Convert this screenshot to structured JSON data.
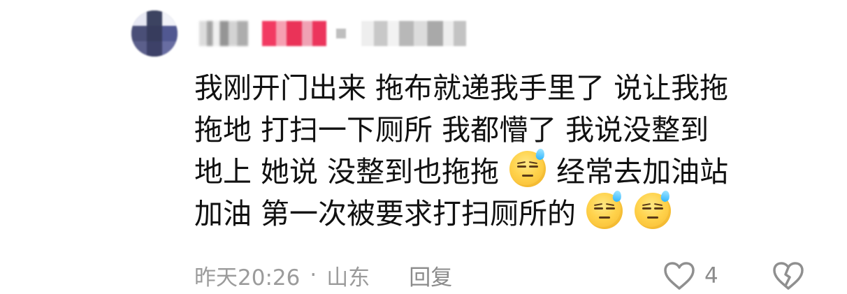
{
  "comment": {
    "content_lines": [
      {
        "a": "我刚开门出来  拖布就递我手里了  说让我拖"
      },
      {
        "a": "拖地 打扫一下厕所  我都懵了  我说没整到"
      },
      {
        "a": "地上  她说 没整到也拖拖",
        "emoji_1": "sweat-smile-icon",
        "b": "经常去加油站"
      },
      {
        "a": "加油 第一次被要求打扫厕所的",
        "emoji_1": "sweat-smile-icon",
        "emoji_2": "sweat-smile-icon"
      }
    ],
    "footer": {
      "time": "昨天20:26",
      "separator": "·",
      "location": "山东",
      "reply_label": "回复",
      "like_count": "4"
    }
  },
  "icons": {
    "like": "heart-outline-icon",
    "dislike": "broken-heart-icon",
    "emoji": "sweat-smile-icon"
  },
  "colors": {
    "text": "#111111",
    "meta": "#9b9b9b",
    "icon": "#8f8f8f",
    "badge": "#f23a62",
    "background": "#ffffff"
  }
}
